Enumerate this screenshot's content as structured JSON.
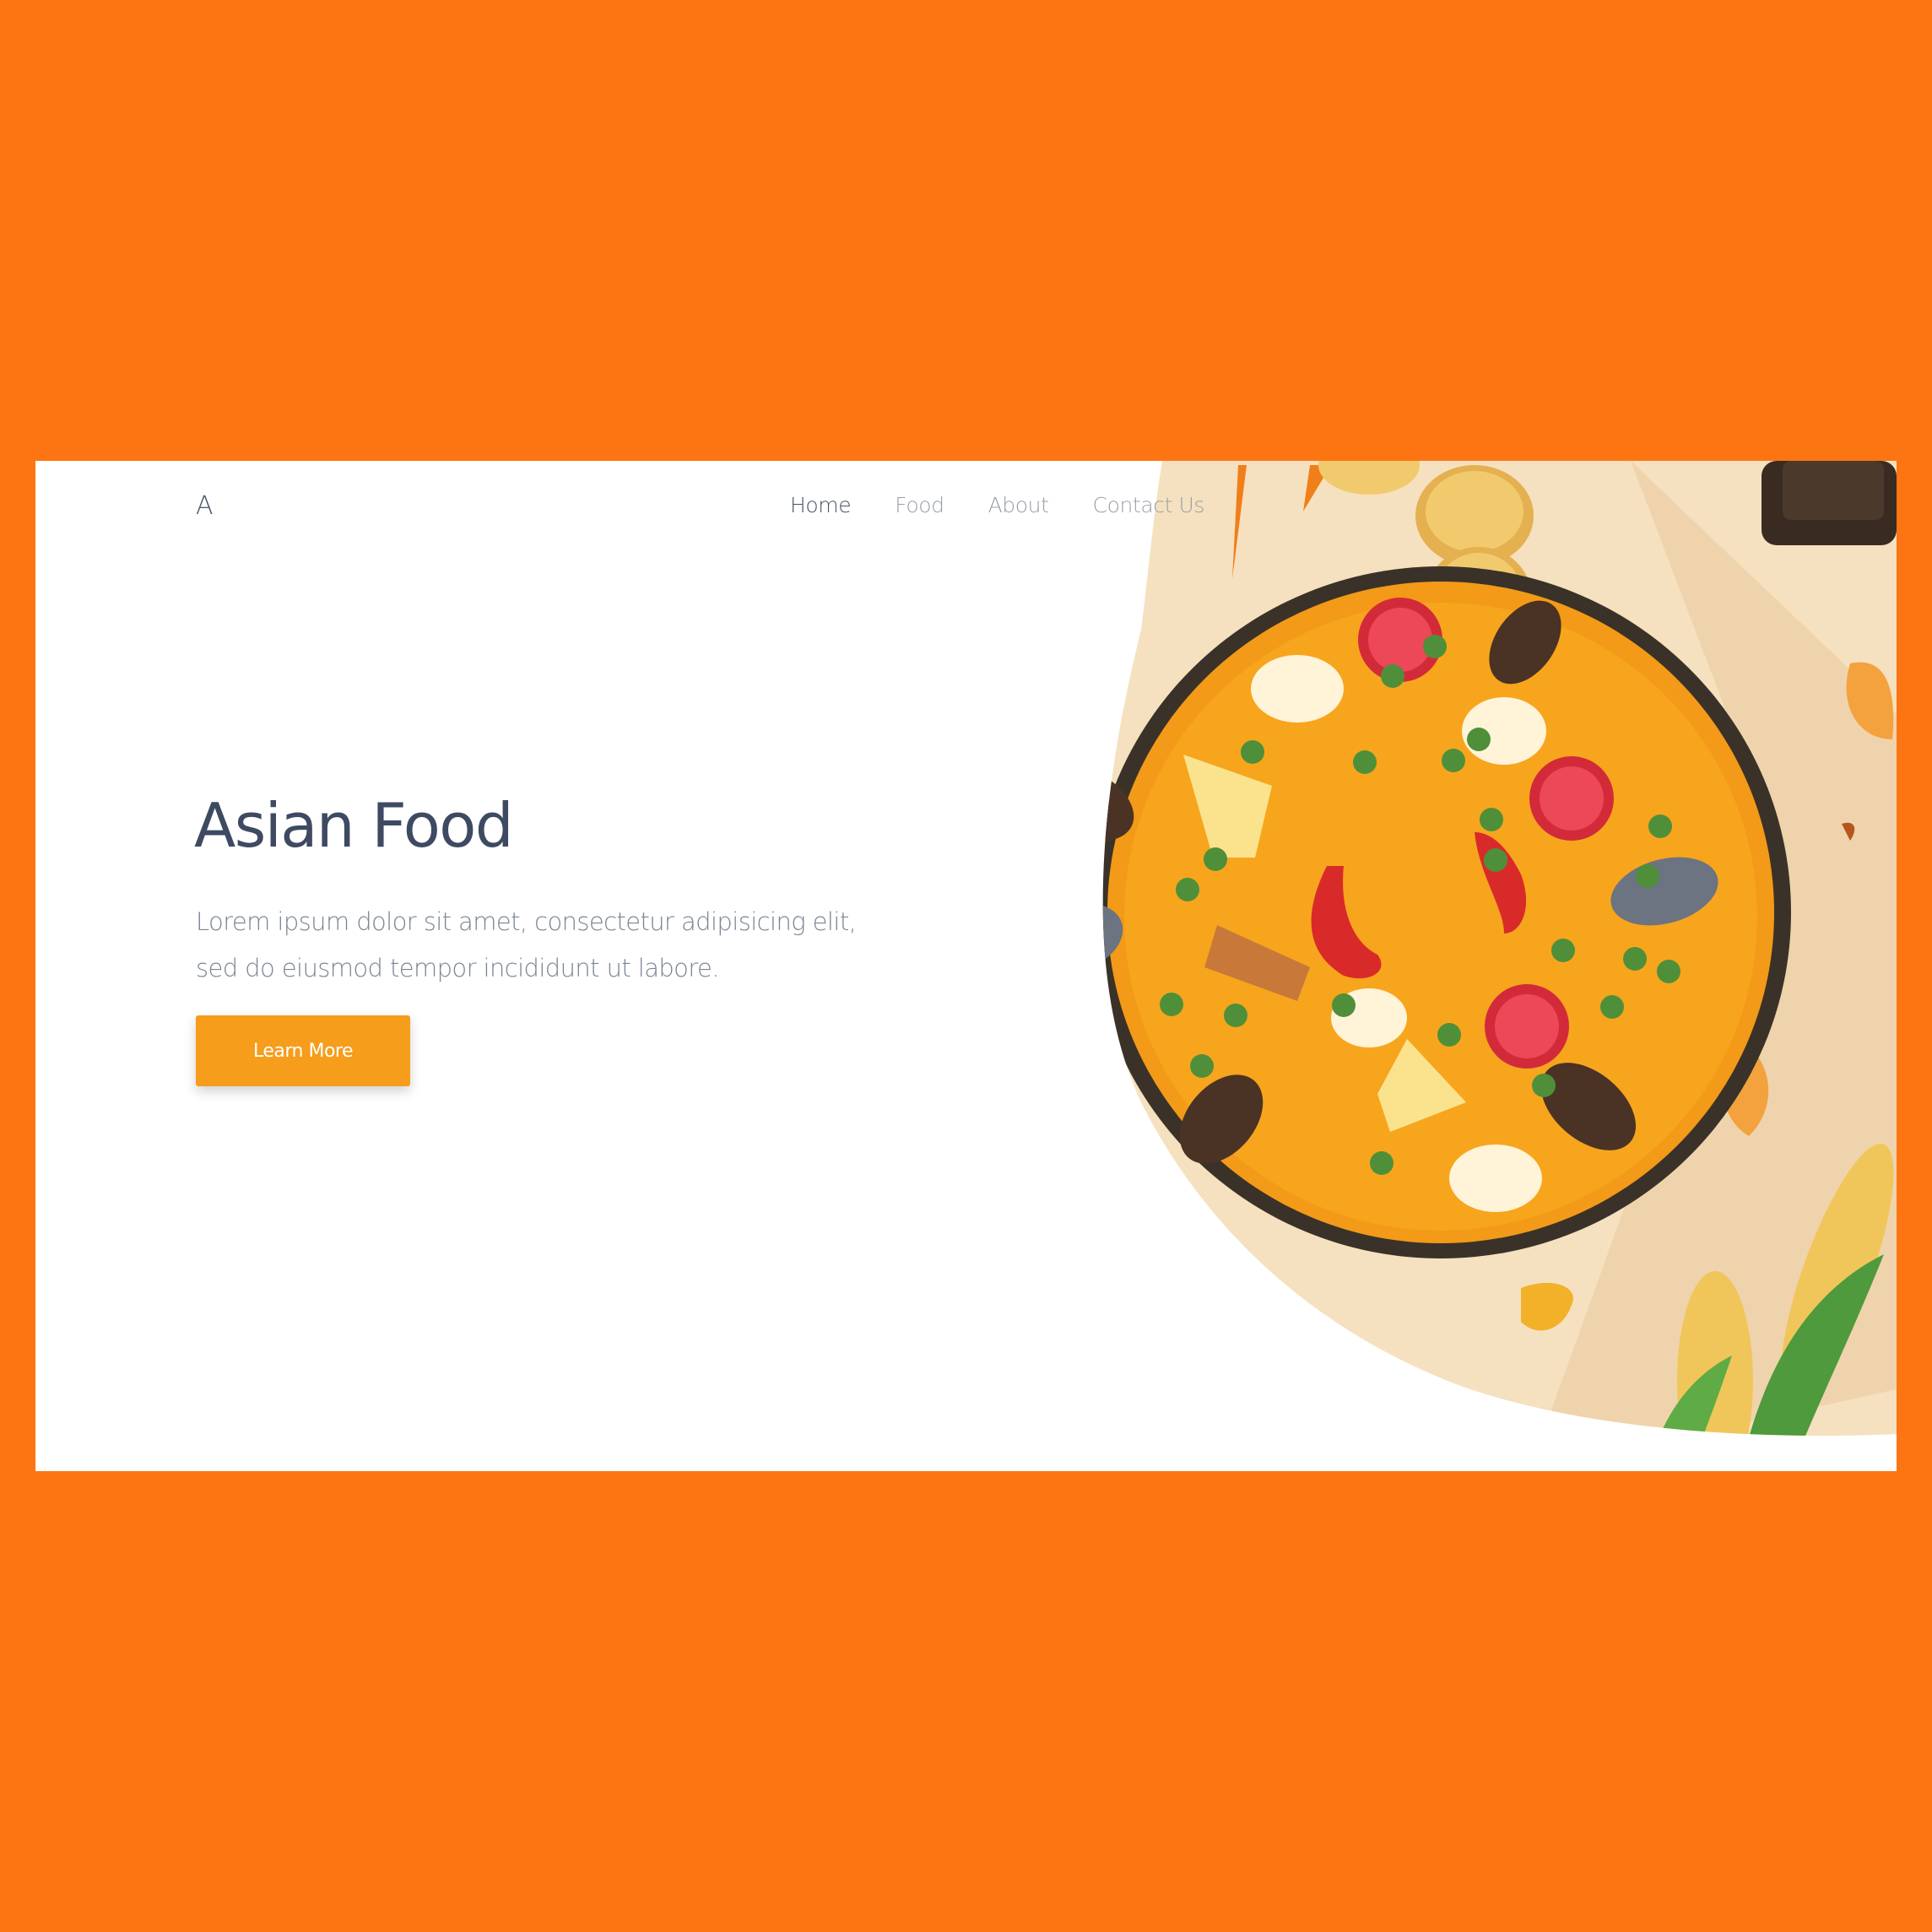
{
  "header": {
    "logo": "A",
    "nav": [
      {
        "label": "Home",
        "active": true
      },
      {
        "label": "Food",
        "active": false
      },
      {
        "label": "About",
        "active": false
      },
      {
        "label": "Contact Us",
        "active": false
      }
    ]
  },
  "hero": {
    "title": "Asian Food",
    "description": "Lorem ipsum dolor sit amet, consectetur adipisicing elit, sed do eiusmod tempor incididunt ut labore.",
    "cta_label": "Learn More",
    "illustration": "paella-pan-illustration"
  },
  "colors": {
    "background": "#fd7513",
    "accent": "#f69d1b",
    "heading": "#3e4a62",
    "text": "#7b8494",
    "card": "#ffffff"
  }
}
